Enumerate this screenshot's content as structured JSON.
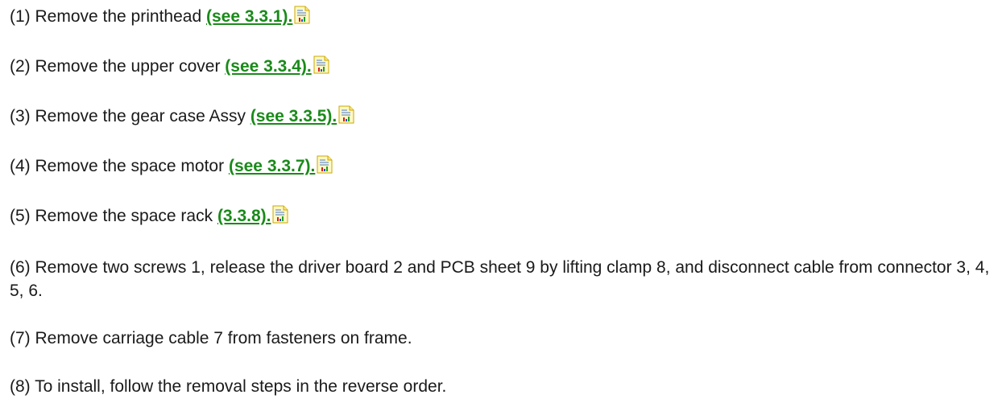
{
  "steps": [
    {
      "text": "(1) Remove the printhead ",
      "ref": "(see 3.3.1).",
      "icon": "document-icon"
    },
    {
      "text": "(2) Remove the upper cover ",
      "ref": "(see 3.3.4).",
      "icon": "document-icon"
    },
    {
      "text": "(3) Remove the gear case Assy ",
      "ref": "(see 3.3.5).",
      "icon": "document-icon"
    },
    {
      "text": "(4) Remove the space motor ",
      "ref": "(see 3.3.7).",
      "icon": "document-icon"
    },
    {
      "text": "(5) Remove the space rack ",
      "ref": "(3.3.8).",
      "icon": "document-icon"
    },
    {
      "text": "(6) Remove two screws 1, release the driver board 2 and PCB sheet 9 by lifting clamp 8, and disconnect cable from connector 3, 4, 5, 6."
    },
    {
      "text": "(7) Remove carriage cable 7 from fasteners on frame."
    },
    {
      "text": "(8) To install, follow the removal steps in the reverse order."
    }
  ],
  "colors": {
    "link": "#1a8a1a",
    "text": "#1a1a1a"
  }
}
